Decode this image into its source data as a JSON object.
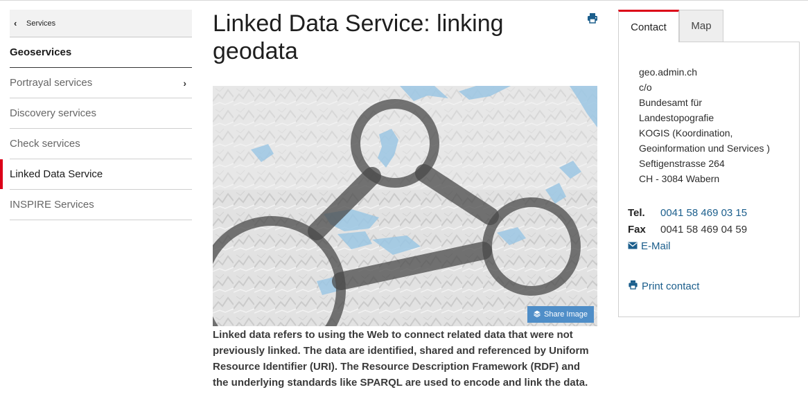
{
  "sidebar": {
    "back_label": "Services",
    "section_title": "Geoservices",
    "items": [
      {
        "label": "Portrayal services",
        "active": false,
        "has_children": true
      },
      {
        "label": "Discovery services",
        "active": false,
        "has_children": false
      },
      {
        "label": "Check services",
        "active": false,
        "has_children": false
      },
      {
        "label": "Linked Data Service",
        "active": true,
        "has_children": false
      },
      {
        "label": "INSPIRE Services",
        "active": false,
        "has_children": false
      }
    ]
  },
  "main": {
    "title": "Linked Data Service: linking geodata",
    "share_label": "Share Image",
    "description": "Linked data refers to using the Web to connect related data that were not previously linked. The data are identified, shared and referenced by Uniform Resource Identifier (URI). The Resource Description Framework (RDF) and the underlying standards like SPARQL are used to encode and link the data."
  },
  "panel": {
    "tabs": [
      "Contact",
      "Map"
    ],
    "address": [
      "geo.admin.ch",
      "c/o",
      "Bundesamt für",
      "Landestopografie",
      "KOGIS (Koordination,",
      "Geoinformation und Services )",
      "Seftigenstrasse 264",
      "CH - 3084 Wabern"
    ],
    "tel_label": "Tel.",
    "tel_value": "0041 58 469 03 15",
    "fax_label": "Fax",
    "fax_value": "0041 58 469 04 59",
    "email_label": "E-Mail",
    "print_label": "Print contact"
  },
  "colors": {
    "accent": "#dc0018",
    "link": "#1b5e8c",
    "share_button": "#4f8ec8",
    "lake": "#9cc7e4"
  },
  "icons": [
    "chevron-left-icon",
    "chevron-right-icon",
    "print-icon",
    "layers-icon",
    "envelope-icon"
  ]
}
